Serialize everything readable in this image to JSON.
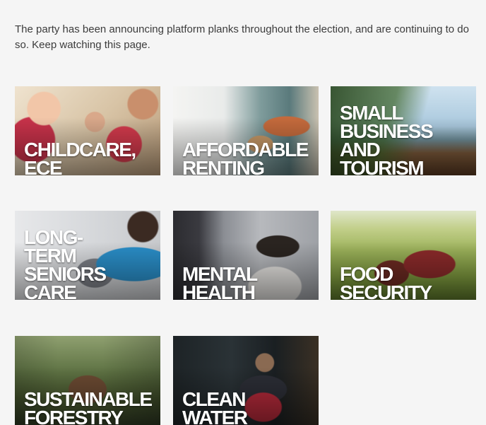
{
  "intro": {
    "text": "The party has been announcing platform planks throughout the election, and are continuing to do so. Keep watching this page."
  },
  "cards": [
    {
      "label": "CHILDCARE,\nECE"
    },
    {
      "label": "AFFORDABLE\nRENTING"
    },
    {
      "label": "SMALL\nBUSINESS\nAND\nTOURISM"
    },
    {
      "label": "LONG-\nTERM\nSENIORS\nCARE"
    },
    {
      "label": "MENTAL\nHEALTH"
    },
    {
      "label": "FOOD\nSECURITY"
    },
    {
      "label": "SUSTAINABLE\nFORESTRY"
    },
    {
      "label": "CLEAN\nWATER"
    }
  ]
}
